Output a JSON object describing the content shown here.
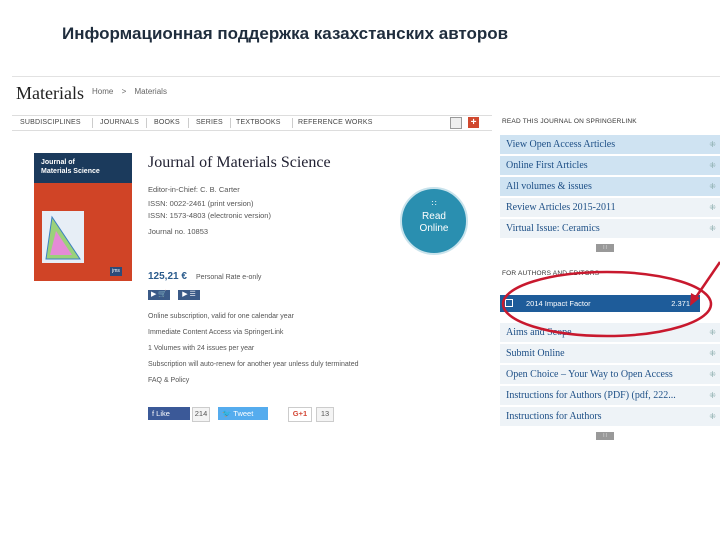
{
  "slide_title": "Информационная поддержка казахстанских авторов",
  "header": {
    "brand": "Materials",
    "breadcrumb": [
      "Home",
      ">",
      "Materials"
    ]
  },
  "nav": {
    "items": [
      "SUBDISCIPLINES",
      "JOURNALS",
      "BOOKS",
      "SERIES",
      "TEXTBOOKS",
      "REFERENCE WORKS"
    ],
    "icons": [
      "square-icon",
      "plus-icon"
    ]
  },
  "cover": {
    "title_line1": "Journal of",
    "title_line2": "Materials Science",
    "publisher_logo": "jms"
  },
  "journal": {
    "title": "Journal of Materials Science",
    "editor": "Editor-in-Chief: C. B. Carter",
    "issn_print": "ISSN: 0022-2461 (print version)",
    "issn_electronic": "ISSN: 1573-4803 (electronic version)",
    "journal_no": "Journal no. 10853"
  },
  "read_online": {
    "dots": "∷",
    "line1": "Read",
    "line2": "Online"
  },
  "pricing": {
    "price": "125,21 €",
    "note": "Personal Rate e-only",
    "cart_label": "▶ 🛒",
    "info_label": "▶ ☰",
    "bullets": [
      "Online subscription, valid for one calendar year",
      "Immediate Content Access via SpringerLink",
      "1 Volumes with 24 issues per year",
      "Subscription will auto-renew for another year unless duly terminated",
      "FAQ & Policy"
    ]
  },
  "social": {
    "like": "f Like",
    "like_count": "214",
    "tweet": "🐦 Tweet",
    "gplus": "G+1",
    "gplus_count": "13"
  },
  "right": {
    "read_heading": "READ THIS JOURNAL ON SPRINGERLINK",
    "read_links": [
      "View Open Access Articles",
      "Online First Articles",
      "All volumes & issues",
      "Review Articles 2015-2011",
      "Virtual Issue: Ceramics"
    ],
    "authors_heading": "FOR AUTHORS AND EDITORS",
    "impact_label": "2014 Impact Factor",
    "impact_value": "2.371",
    "author_links": [
      "Aims and Scope",
      "Submit Online",
      "Open Choice – Your Way to Open Access",
      "Instructions for Authors (PDF) (pdf, 222...",
      "Instructions for Authors"
    ],
    "toggle_symbol": "∷"
  },
  "colors": {
    "annotation": "#c8192e",
    "link": "#1d4f86",
    "impact_bar": "#1e5c9a"
  }
}
